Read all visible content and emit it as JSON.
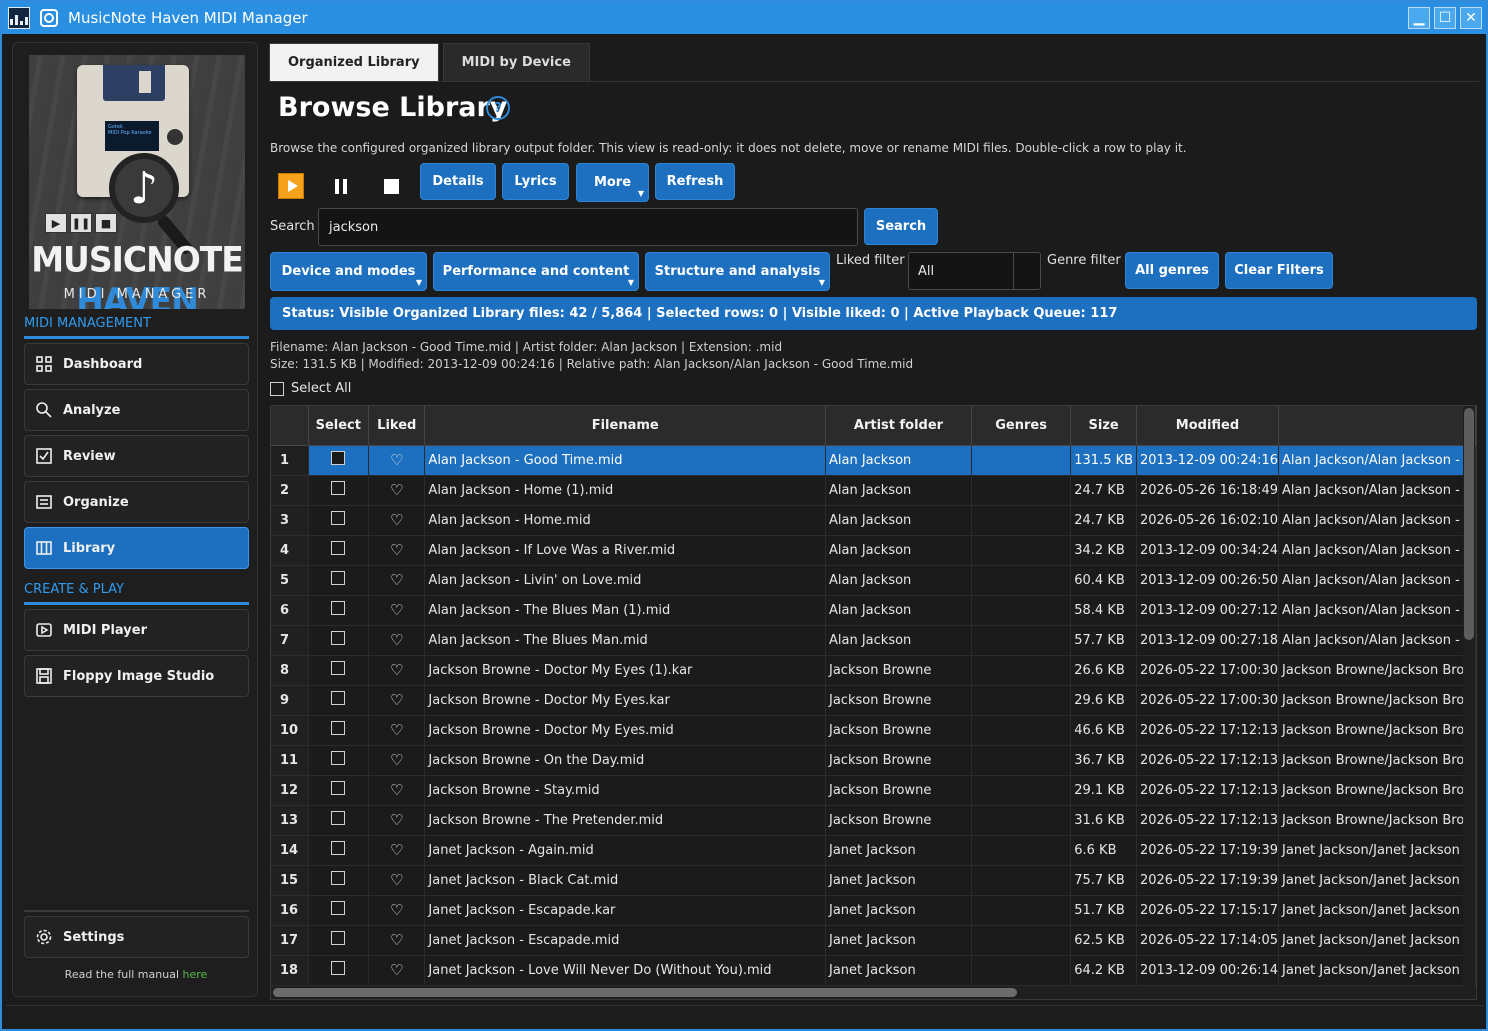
{
  "window": {
    "title": "MusicNote Haven MIDI Manager",
    "buttons": {
      "minimize": "▁",
      "maximize": "☐",
      "close": "✕"
    }
  },
  "cover": {
    "brand_white": "MUSICNOTE",
    "brand_blue": "HAVEN",
    "subtitle": "MIDI MANAGER",
    "screen_line1": "Gotek",
    "screen_line2": "MIDI Pop Karaoke",
    "note": "♪",
    "controls": [
      "▶",
      "❚❚",
      "■"
    ]
  },
  "sidebar": {
    "section1": "MIDI MANAGEMENT",
    "section2": "CREATE & PLAY",
    "items": [
      {
        "label": "Dashboard",
        "icon": "grid-icon"
      },
      {
        "label": "Analyze",
        "icon": "search-icon"
      },
      {
        "label": "Review",
        "icon": "checkbox-icon"
      },
      {
        "label": "Organize",
        "icon": "list-icon"
      },
      {
        "label": "Library",
        "icon": "columns-icon",
        "active": true
      },
      {
        "label": "MIDI Player",
        "icon": "player-icon"
      },
      {
        "label": "Floppy Image Studio",
        "icon": "floppy-icon"
      }
    ],
    "settings": "Settings",
    "manual_text": "Read the full manual ",
    "manual_link": "here"
  },
  "tabs": [
    {
      "label": "Organized Library",
      "active": true
    },
    {
      "label": "MIDI by Device",
      "active": false
    }
  ],
  "page": {
    "title": "Browse Library",
    "help": "?",
    "description": "Browse the configured organized library output folder. This view is read-only: it does not delete, move or rename MIDI files. Double-click a row to play it."
  },
  "toolbar": {
    "details": "Details",
    "lyrics": "Lyrics",
    "more": "More",
    "refresh": "Refresh"
  },
  "search": {
    "label": "Search",
    "value": "jackson",
    "button": "Search"
  },
  "filters": {
    "device_modes": "Device and modes",
    "performance": "Performance and content",
    "structure": "Structure and analysis",
    "liked_label": "Liked filter",
    "liked_value": "All",
    "genre_label": "Genre filter",
    "all_genres": "All genres",
    "clear": "Clear Filters"
  },
  "status": "Status: Visible Organized Library files: 42 / 5,864 | Selected rows: 0 | Visible liked: 0 | Active Playback Queue: 117",
  "selection_info": {
    "line1": "Filename: Alan Jackson - Good Time.mid | Artist folder: Alan Jackson | Extension: .mid",
    "line2": "Size: 131.5 KB | Modified: 2013-12-09 00:24:16 | Relative path: Alan Jackson/Alan Jackson - Good Time.mid"
  },
  "select_all": "Select All",
  "table": {
    "headers": [
      "",
      "Select",
      "Liked",
      "Filename",
      "Artist folder",
      "Genres",
      "Size",
      "Modified",
      ""
    ],
    "heart": "♡",
    "rows": [
      {
        "n": "1",
        "file": "Alan Jackson - Good Time.mid",
        "artist": "Alan Jackson",
        "size": "131.5 KB",
        "mod": "2013-12-09 00:24:16",
        "path": "Alan Jackson/Alan Jackson - G"
      },
      {
        "n": "2",
        "file": "Alan Jackson - Home (1).mid",
        "artist": "Alan Jackson",
        "size": "24.7 KB",
        "mod": "2026-05-26 16:18:49",
        "path": "Alan Jackson/Alan Jackson - H"
      },
      {
        "n": "3",
        "file": "Alan Jackson - Home.mid",
        "artist": "Alan Jackson",
        "size": "24.7 KB",
        "mod": "2026-05-26 16:02:10",
        "path": "Alan Jackson/Alan Jackson - H"
      },
      {
        "n": "4",
        "file": "Alan Jackson - If Love Was a River.mid",
        "artist": "Alan Jackson",
        "size": "34.2 KB",
        "mod": "2013-12-09 00:34:24",
        "path": "Alan Jackson/Alan Jackson - If"
      },
      {
        "n": "5",
        "file": "Alan Jackson - Livin' on Love.mid",
        "artist": "Alan Jackson",
        "size": "60.4 KB",
        "mod": "2013-12-09 00:26:50",
        "path": "Alan Jackson/Alan Jackson - L"
      },
      {
        "n": "6",
        "file": "Alan Jackson - The Blues Man (1).mid",
        "artist": "Alan Jackson",
        "size": "58.4 KB",
        "mod": "2013-12-09 00:27:12",
        "path": "Alan Jackson/Alan Jackson - T"
      },
      {
        "n": "7",
        "file": "Alan Jackson - The Blues Man.mid",
        "artist": "Alan Jackson",
        "size": "57.7 KB",
        "mod": "2013-12-09 00:27:18",
        "path": "Alan Jackson/Alan Jackson - T"
      },
      {
        "n": "8",
        "file": "Jackson Browne - Doctor My Eyes (1).kar",
        "artist": "Jackson Browne",
        "size": "26.6 KB",
        "mod": "2026-05-22 17:00:30",
        "path": "Jackson Browne/Jackson Brow"
      },
      {
        "n": "9",
        "file": "Jackson Browne - Doctor My Eyes.kar",
        "artist": "Jackson Browne",
        "size": "29.6 KB",
        "mod": "2026-05-22 17:00:30",
        "path": "Jackson Browne/Jackson Brow"
      },
      {
        "n": "10",
        "file": "Jackson Browne - Doctor My Eyes.mid",
        "artist": "Jackson Browne",
        "size": "46.6 KB",
        "mod": "2026-05-22 17:12:13",
        "path": "Jackson Browne/Jackson Brow"
      },
      {
        "n": "11",
        "file": "Jackson Browne - On the Day.mid",
        "artist": "Jackson Browne",
        "size": "36.7 KB",
        "mod": "2026-05-22 17:12:13",
        "path": "Jackson Browne/Jackson Brow"
      },
      {
        "n": "12",
        "file": "Jackson Browne - Stay.mid",
        "artist": "Jackson Browne",
        "size": "29.1 KB",
        "mod": "2026-05-22 17:12:13",
        "path": "Jackson Browne/Jackson Brow"
      },
      {
        "n": "13",
        "file": "Jackson Browne - The Pretender.mid",
        "artist": "Jackson Browne",
        "size": "31.6 KB",
        "mod": "2026-05-22 17:12:13",
        "path": "Jackson Browne/Jackson Brow"
      },
      {
        "n": "14",
        "file": "Janet Jackson - Again.mid",
        "artist": "Janet Jackson",
        "size": "6.6 KB",
        "mod": "2026-05-22 17:19:39",
        "path": "Janet Jackson/Janet Jackson -"
      },
      {
        "n": "15",
        "file": "Janet Jackson - Black Cat.mid",
        "artist": "Janet Jackson",
        "size": "75.7 KB",
        "mod": "2026-05-22 17:19:39",
        "path": "Janet Jackson/Janet Jackson -"
      },
      {
        "n": "16",
        "file": "Janet Jackson - Escapade.kar",
        "artist": "Janet Jackson",
        "size": "51.7 KB",
        "mod": "2026-05-22 17:15:17",
        "path": "Janet Jackson/Janet Jackson -"
      },
      {
        "n": "17",
        "file": "Janet Jackson - Escapade.mid",
        "artist": "Janet Jackson",
        "size": "62.5 KB",
        "mod": "2026-05-22 17:14:05",
        "path": "Janet Jackson/Janet Jackson -"
      },
      {
        "n": "18",
        "file": "Janet Jackson - Love Will Never Do (Without You).mid",
        "artist": "Janet Jackson",
        "size": "64.2 KB",
        "mod": "2013-12-09 00:26:14",
        "path": "Janet Jackson/Janet Jackson -"
      }
    ]
  }
}
